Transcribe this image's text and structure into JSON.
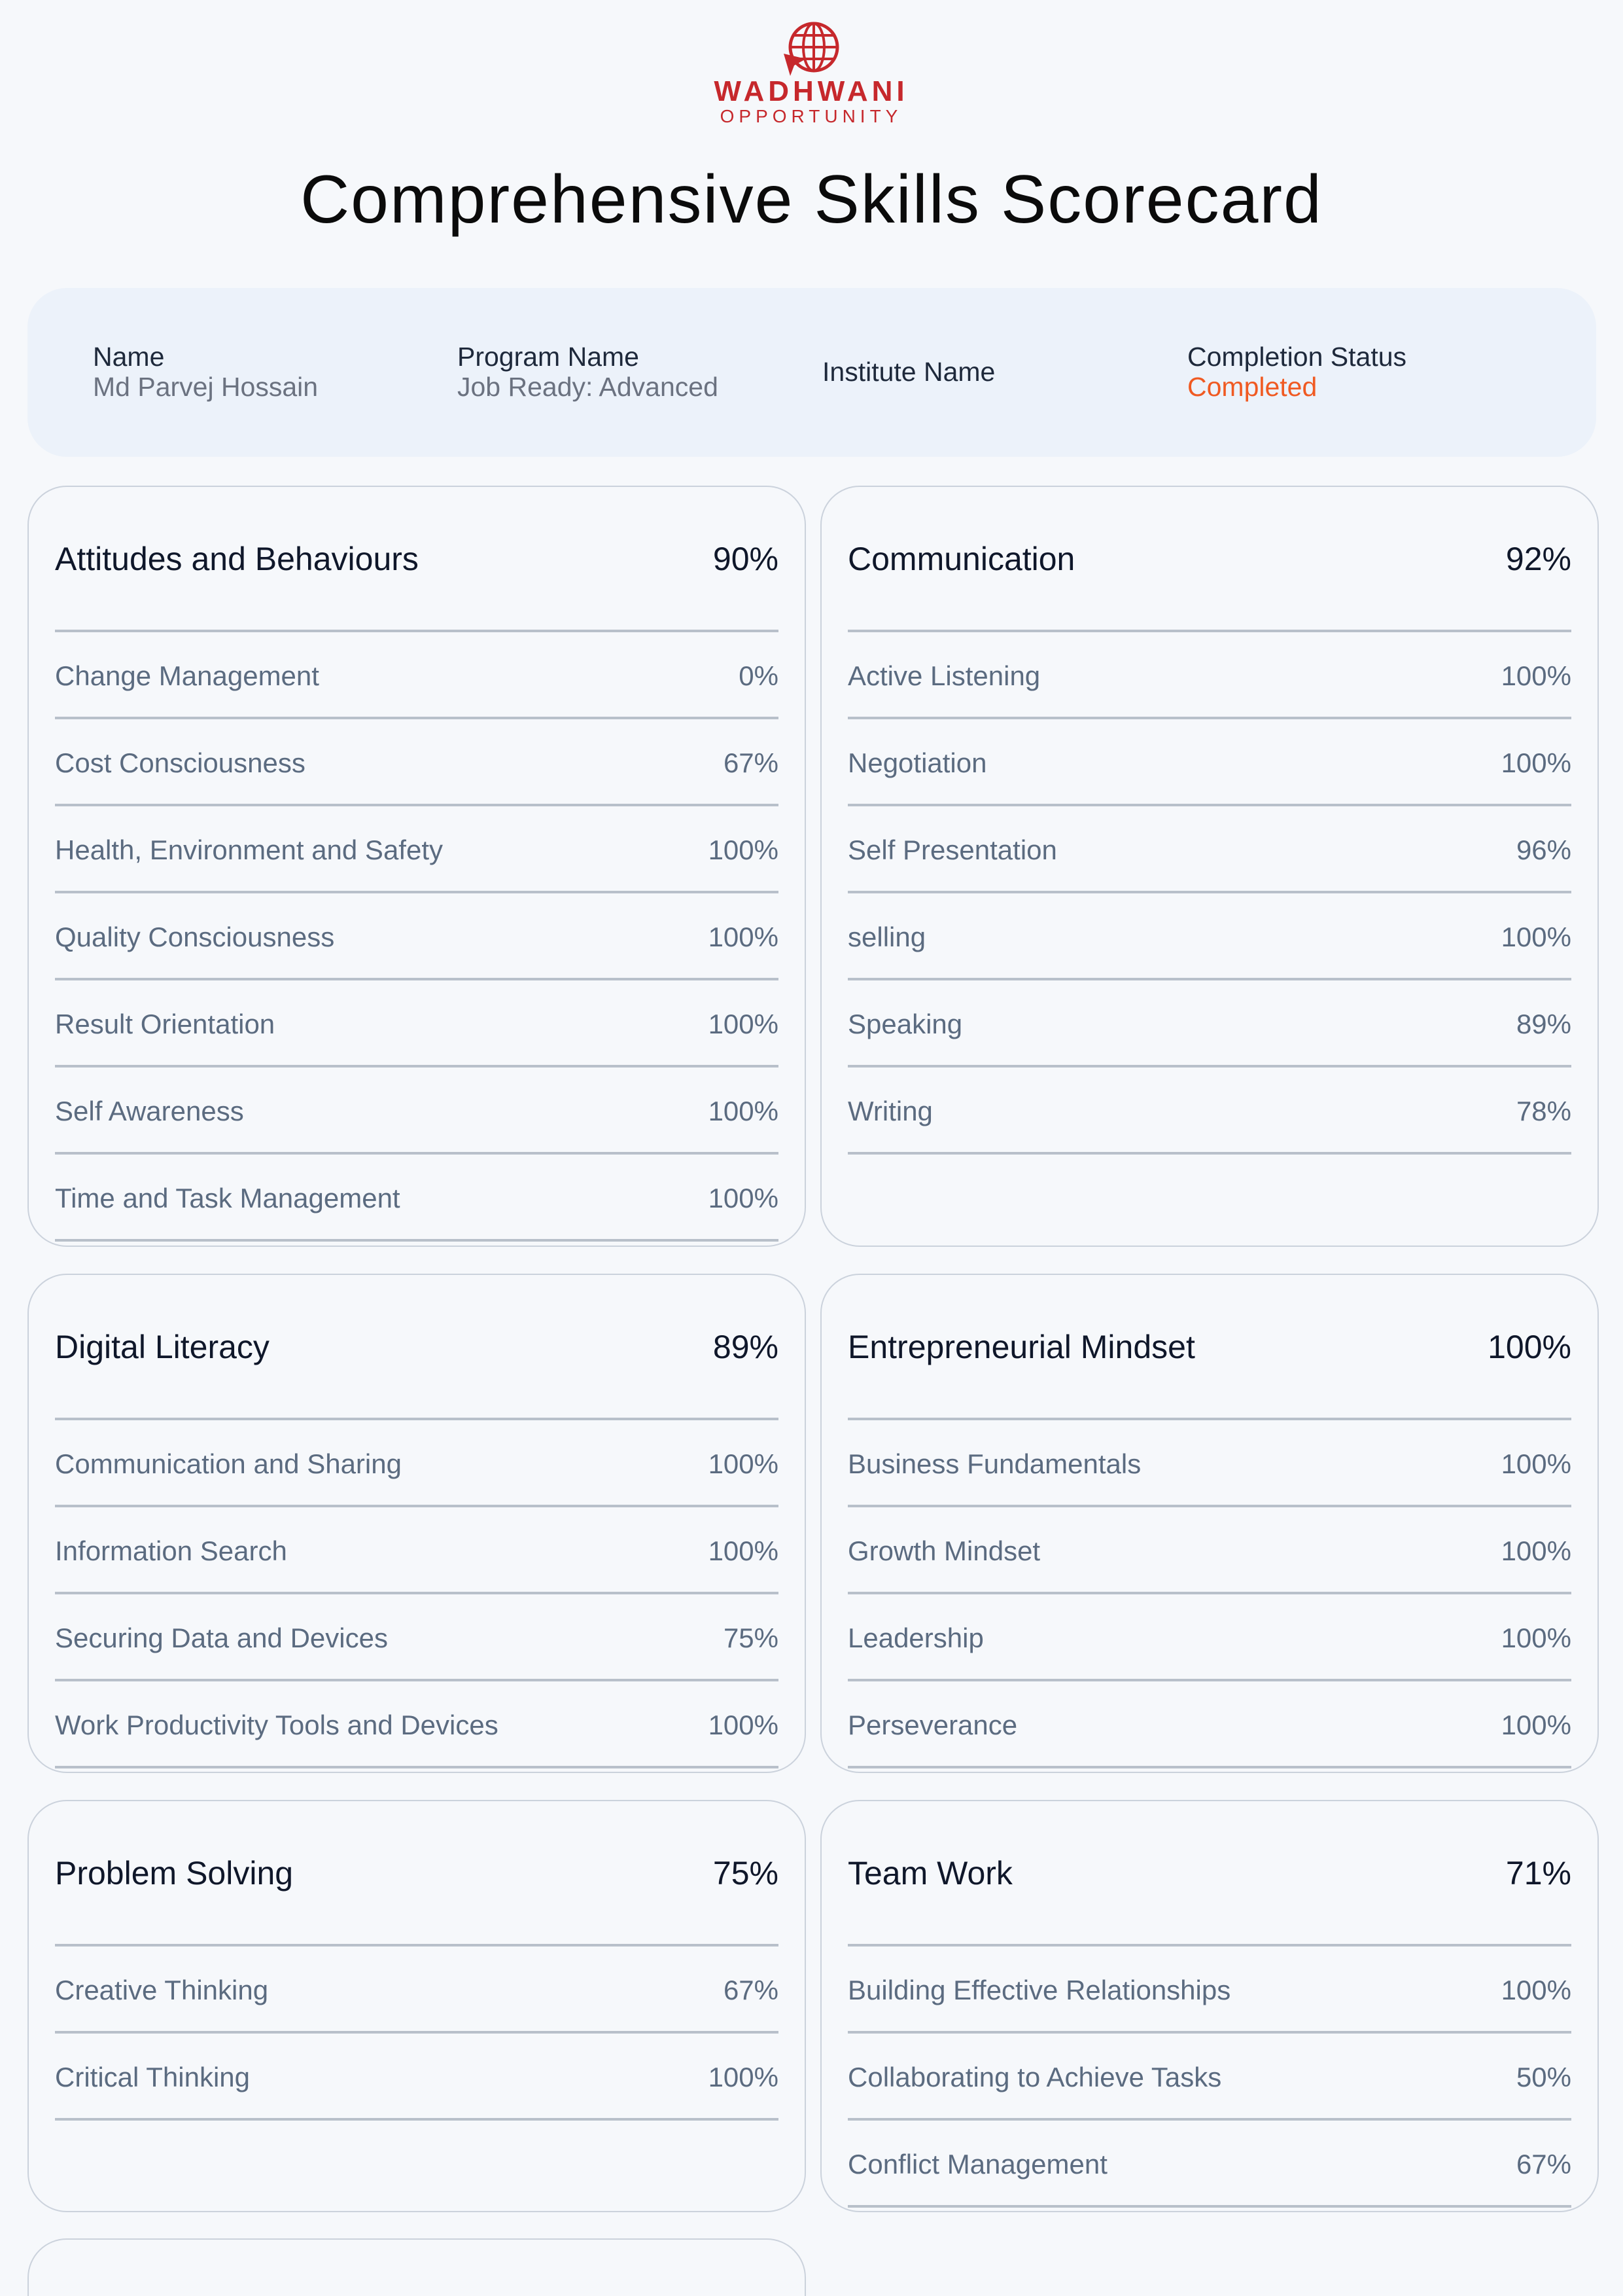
{
  "brand": {
    "name": "WADHWANI",
    "sub": "OPPORTUNITY",
    "color": "#c6282c"
  },
  "title": "Comprehensive Skills Scorecard",
  "info": {
    "name_label": "Name",
    "name_value": "Md Parvej Hossain",
    "program_label": "Program Name",
    "program_value": "Job Ready: Advanced",
    "institute_label": "Institute Name",
    "status_label": "Completion Status",
    "status_value": "Completed",
    "status_color": "#f05a22"
  },
  "cards": [
    {
      "title": "Attitudes and Behaviours",
      "score": "90%",
      "items": [
        {
          "label": "Change Management",
          "value": "0%"
        },
        {
          "label": "Cost Consciousness",
          "value": "67%"
        },
        {
          "label": "Health, Environment and Safety",
          "value": "100%"
        },
        {
          "label": "Quality Consciousness",
          "value": "100%"
        },
        {
          "label": "Result Orientation",
          "value": "100%"
        },
        {
          "label": "Self Awareness",
          "value": "100%"
        },
        {
          "label": "Time and Task Management",
          "value": "100%"
        }
      ]
    },
    {
      "title": "Communication",
      "score": "92%",
      "items": [
        {
          "label": "Active Listening",
          "value": "100%"
        },
        {
          "label": "Negotiation",
          "value": "100%"
        },
        {
          "label": "Self Presentation",
          "value": "96%"
        },
        {
          "label": "selling",
          "value": "100%"
        },
        {
          "label": "Speaking",
          "value": "89%"
        },
        {
          "label": "Writing",
          "value": "78%"
        }
      ]
    },
    {
      "title": "Digital Literacy",
      "score": "89%",
      "items": [
        {
          "label": "Communication and Sharing",
          "value": "100%"
        },
        {
          "label": "Information Search",
          "value": "100%"
        },
        {
          "label": "Securing Data and Devices",
          "value": "75%"
        },
        {
          "label": "Work Productivity Tools and Devices",
          "value": "100%"
        }
      ]
    },
    {
      "title": "Entrepreneurial Mindset",
      "score": "100%",
      "items": [
        {
          "label": "Business Fundamentals",
          "value": "100%"
        },
        {
          "label": "Growth Mindset",
          "value": "100%"
        },
        {
          "label": "Leadership",
          "value": "100%"
        },
        {
          "label": "Perseverance",
          "value": "100%"
        }
      ]
    },
    {
      "title": "Problem Solving",
      "score": "75%",
      "items": [
        {
          "label": "Creative Thinking",
          "value": "67%"
        },
        {
          "label": "Critical Thinking",
          "value": "100%"
        }
      ]
    },
    {
      "title": "Team Work",
      "score": "71%",
      "items": [
        {
          "label": "Building Effective Relationships",
          "value": "100%"
        },
        {
          "label": "Collaborating to Achieve Tasks",
          "value": "50%"
        },
        {
          "label": "Conflict Management",
          "value": "67%"
        }
      ]
    }
  ]
}
